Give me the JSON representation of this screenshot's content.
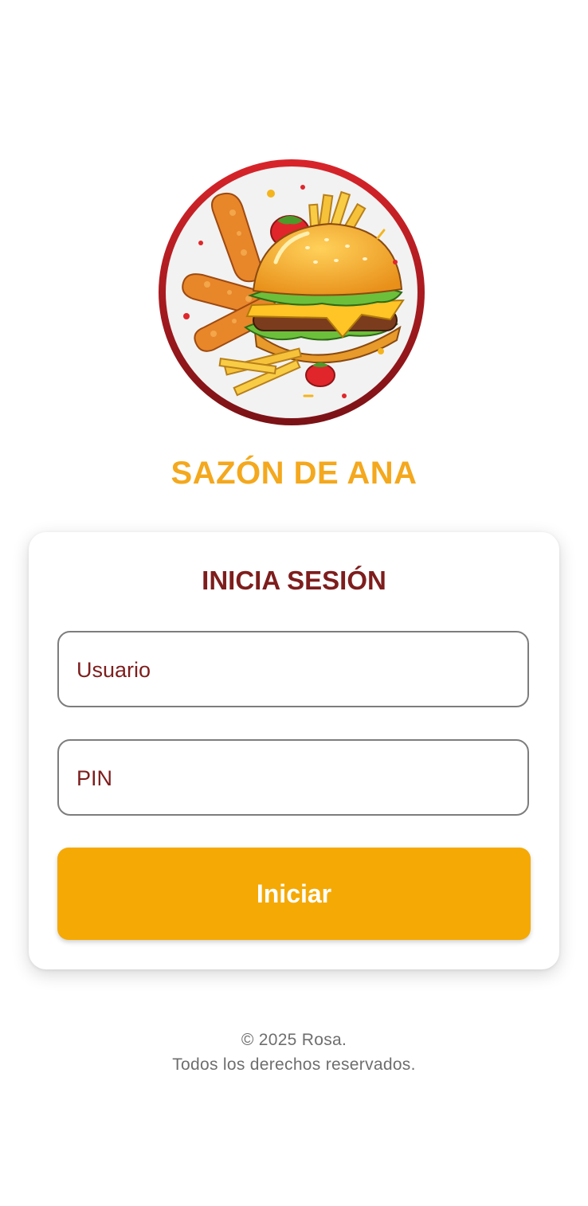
{
  "brand": {
    "name": "SAZÓN DE ANA",
    "color": "#F4A81D"
  },
  "login": {
    "title": "INICIA SESIÓN",
    "username_placeholder": "Usuario",
    "pin_placeholder": "PIN",
    "submit_label": "Iniciar"
  },
  "footer": {
    "copyright": "© 2025 Rosa.",
    "rights": "Todos los derechos reservados."
  },
  "colors": {
    "accent": "#F5A905",
    "title": "#7E1D1D",
    "logo_ring": "#C0191C"
  }
}
